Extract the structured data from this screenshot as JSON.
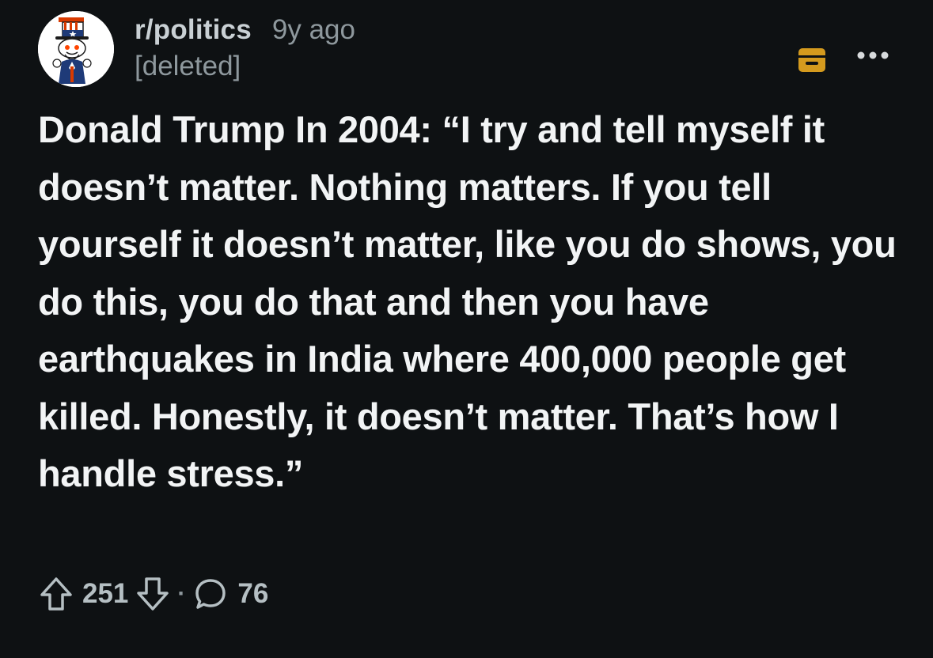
{
  "post": {
    "subreddit": "r/politics",
    "time_ago": "9y ago",
    "author": "[deleted]",
    "title": "Donald Trump In 2004: “I try and tell myself it doesn’t matter. Nothing matters. If you tell yourself it doesn’t matter, like you do shows, you do this, you do that and then you have earthquakes in India where 400,000 people get killed. Honestly, it doesn’t matter. That’s how I handle stress.”",
    "score": "251",
    "separator": "·",
    "comment_count": "76"
  },
  "icons": {
    "avatar": "uncle-sam-snoo-avatar",
    "archive": "archive-icon",
    "more": "more-options-icon",
    "upvote": "upvote-arrow-icon",
    "downvote": "downvote-arrow-icon",
    "comment": "comment-bubble-icon"
  },
  "colors": {
    "background": "#0e1113",
    "text": "#f2f4f5",
    "meta": "#8e989d",
    "archive_accent": "#d49a1e"
  }
}
